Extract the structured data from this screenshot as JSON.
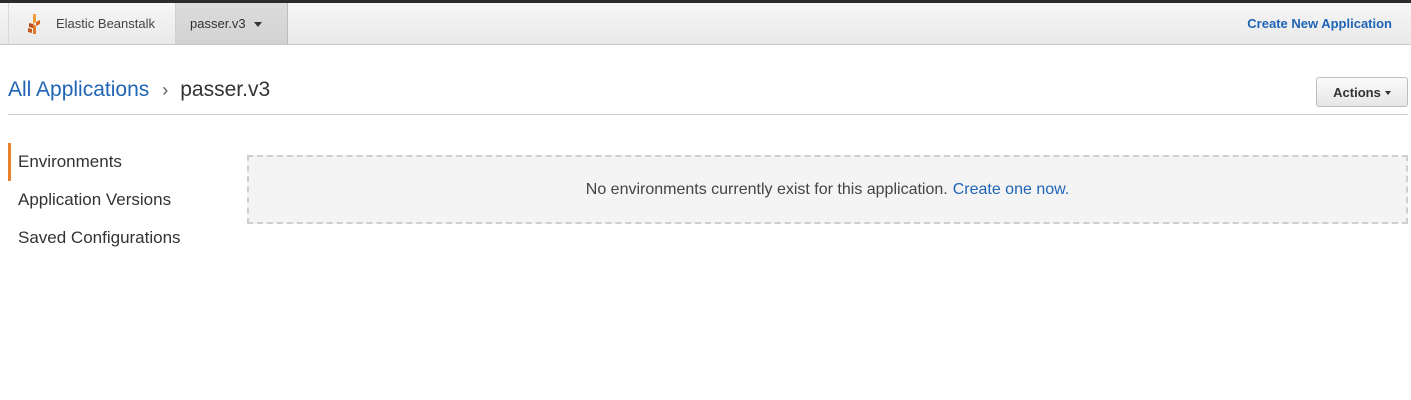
{
  "topbar": {
    "brand_label": "Elastic Beanstalk",
    "brand_icon": "elastic-beanstalk-logo-icon",
    "app_tab_label": "passer.v3",
    "create_app_label": "Create New Application"
  },
  "header": {
    "breadcrumb_root": "All Applications",
    "breadcrumb_separator": "›",
    "breadcrumb_current": "passer.v3",
    "actions_label": "Actions"
  },
  "sidebar": {
    "items": [
      {
        "label": "Environments",
        "active": true
      },
      {
        "label": "Application Versions",
        "active": false
      },
      {
        "label": "Saved Configurations",
        "active": false
      }
    ]
  },
  "main": {
    "empty_message": "No environments currently exist for this application.",
    "empty_link": "Create one now."
  },
  "colors": {
    "link": "#1f64b5",
    "active_indicator": "#e9822f",
    "brand_orange": "#e07b2c"
  }
}
